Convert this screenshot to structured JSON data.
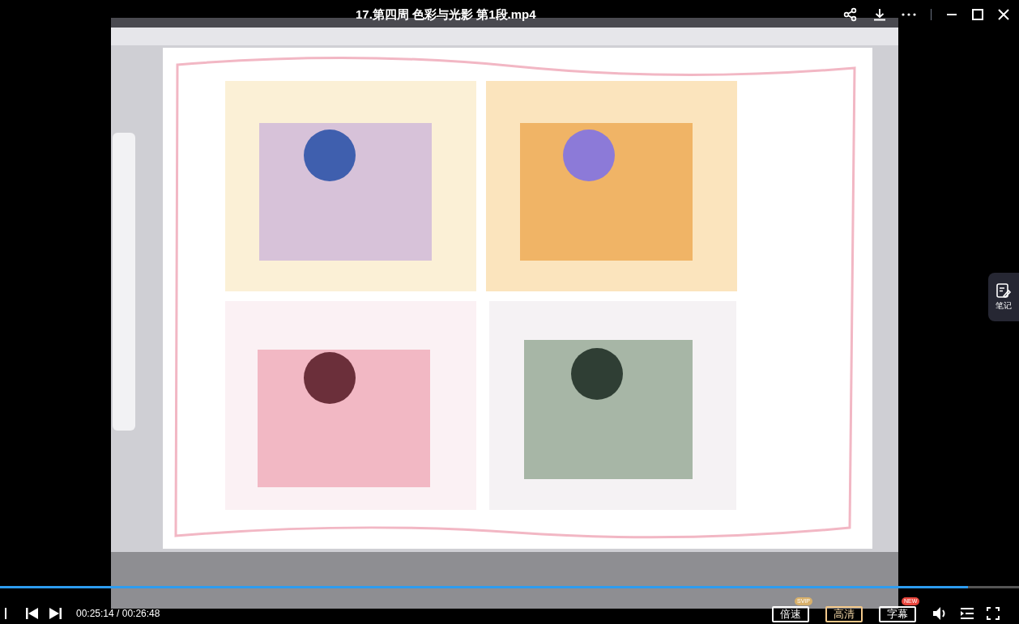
{
  "title": "17.第四周 色彩与光影 第1段.mp4",
  "side_panel": {
    "label": "笔记"
  },
  "progress": {
    "level": 0.95
  },
  "time": "00:25:14 / 00:26:48",
  "buttons": [
    {
      "label": "倍速",
      "badge": "SVIP",
      "color": "#d8b06a",
      "selected": false
    },
    {
      "label": "高清",
      "selected": true
    },
    {
      "label": "字幕",
      "badge": "NEW",
      "color": "#e8453c",
      "selected": false
    }
  ]
}
